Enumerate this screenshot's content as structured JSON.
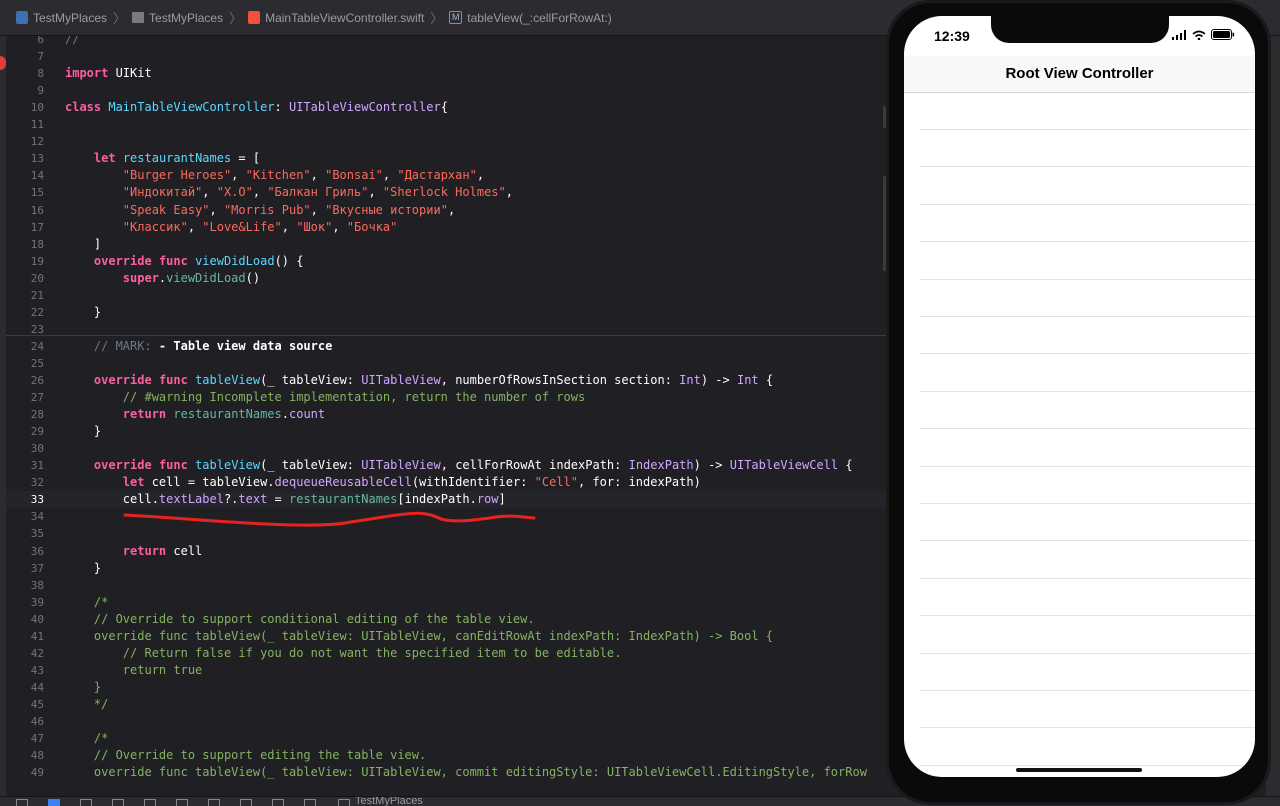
{
  "breadcrumb": {
    "project": "TestMyPlaces",
    "folder": "TestMyPlaces",
    "file": "MainTableViewController.swift",
    "method_badge": "M",
    "method": "tableView(_:cellForRowAt:)",
    "separator": "〉"
  },
  "editor": {
    "current_line": 33,
    "lines": [
      {
        "n": "6",
        "segs": [
          {
            "t": "//",
            "c": "cm"
          }
        ]
      },
      {
        "n": "7",
        "segs": []
      },
      {
        "n": "8",
        "segs": [
          {
            "t": "import",
            "c": "kw"
          },
          {
            "t": " UIKit",
            "c": ""
          }
        ]
      },
      {
        "n": "9",
        "segs": []
      },
      {
        "n": "10",
        "segs": [
          {
            "t": "class",
            "c": "kw"
          },
          {
            "t": " ",
            "c": ""
          },
          {
            "t": "MainTableViewController",
            "c": "ty"
          },
          {
            "t": ": ",
            "c": ""
          },
          {
            "t": "UITableViewController",
            "c": "pty"
          },
          {
            "t": "{",
            "c": ""
          }
        ]
      },
      {
        "n": "11",
        "segs": []
      },
      {
        "n": "12",
        "segs": []
      },
      {
        "n": "13",
        "segs": [
          {
            "t": "    ",
            "c": ""
          },
          {
            "t": "let",
            "c": "kw"
          },
          {
            "t": " ",
            "c": ""
          },
          {
            "t": "restaurantNames",
            "c": "ty"
          },
          {
            "t": " = [",
            "c": ""
          }
        ]
      },
      {
        "n": "14",
        "segs": [
          {
            "t": "        ",
            "c": ""
          },
          {
            "t": "\"Burger Heroes\"",
            "c": "st"
          },
          {
            "t": ", ",
            "c": ""
          },
          {
            "t": "\"Kitchen\"",
            "c": "st"
          },
          {
            "t": ", ",
            "c": ""
          },
          {
            "t": "\"Bonsai\"",
            "c": "st"
          },
          {
            "t": ", ",
            "c": ""
          },
          {
            "t": "\"Дастархан\"",
            "c": "st"
          },
          {
            "t": ",",
            "c": ""
          }
        ]
      },
      {
        "n": "15",
        "segs": [
          {
            "t": "        ",
            "c": ""
          },
          {
            "t": "\"Индокитай\"",
            "c": "st"
          },
          {
            "t": ", ",
            "c": ""
          },
          {
            "t": "\"X.O\"",
            "c": "st"
          },
          {
            "t": ", ",
            "c": ""
          },
          {
            "t": "\"Балкан Гриль\"",
            "c": "st"
          },
          {
            "t": ", ",
            "c": ""
          },
          {
            "t": "\"Sherlock Holmes\"",
            "c": "st"
          },
          {
            "t": ",",
            "c": ""
          }
        ]
      },
      {
        "n": "16",
        "segs": [
          {
            "t": "        ",
            "c": ""
          },
          {
            "t": "\"Speak Easy\"",
            "c": "st"
          },
          {
            "t": ", ",
            "c": ""
          },
          {
            "t": "\"Morris Pub\"",
            "c": "st"
          },
          {
            "t": ", ",
            "c": ""
          },
          {
            "t": "\"Вкусные истории\"",
            "c": "st"
          },
          {
            "t": ",",
            "c": ""
          }
        ]
      },
      {
        "n": "17",
        "segs": [
          {
            "t": "        ",
            "c": ""
          },
          {
            "t": "\"Классик\"",
            "c": "st"
          },
          {
            "t": ", ",
            "c": ""
          },
          {
            "t": "\"Love&Life\"",
            "c": "st"
          },
          {
            "t": ", ",
            "c": ""
          },
          {
            "t": "\"Шок\"",
            "c": "st"
          },
          {
            "t": ", ",
            "c": ""
          },
          {
            "t": "\"Бочка\"",
            "c": "st"
          }
        ]
      },
      {
        "n": "18",
        "segs": [
          {
            "t": "    ]",
            "c": ""
          }
        ]
      },
      {
        "n": "19",
        "segs": [
          {
            "t": "    ",
            "c": ""
          },
          {
            "t": "override",
            "c": "kw"
          },
          {
            "t": " ",
            "c": ""
          },
          {
            "t": "func",
            "c": "kw"
          },
          {
            "t": " ",
            "c": ""
          },
          {
            "t": "viewDidLoad",
            "c": "ty"
          },
          {
            "t": "() {",
            "c": ""
          }
        ]
      },
      {
        "n": "20",
        "segs": [
          {
            "t": "        ",
            "c": ""
          },
          {
            "t": "super",
            "c": "kw"
          },
          {
            "t": ".",
            "c": ""
          },
          {
            "t": "viewDidLoad",
            "c": "prop"
          },
          {
            "t": "()",
            "c": ""
          }
        ]
      },
      {
        "n": "21",
        "segs": []
      },
      {
        "n": "22",
        "segs": [
          {
            "t": "    }",
            "c": ""
          }
        ]
      },
      {
        "n": "23",
        "segs": []
      },
      {
        "n": "24",
        "segs": [
          {
            "t": "    // MARK: ",
            "c": "cm"
          },
          {
            "t": "- Table view data source",
            "c": "mark-b"
          }
        ]
      },
      {
        "n": "25",
        "segs": []
      },
      {
        "n": "26",
        "segs": [
          {
            "t": "    ",
            "c": ""
          },
          {
            "t": "override",
            "c": "kw"
          },
          {
            "t": " ",
            "c": ""
          },
          {
            "t": "func",
            "c": "kw"
          },
          {
            "t": " ",
            "c": ""
          },
          {
            "t": "tableView",
            "c": "ty"
          },
          {
            "t": "(_ tableView: ",
            "c": ""
          },
          {
            "t": "UITableView",
            "c": "pty"
          },
          {
            "t": ", numberOfRowsInSection section: ",
            "c": ""
          },
          {
            "t": "Int",
            "c": "pty"
          },
          {
            "t": ") -> ",
            "c": ""
          },
          {
            "t": "Int",
            "c": "pty"
          },
          {
            "t": " {",
            "c": ""
          }
        ]
      },
      {
        "n": "27",
        "segs": [
          {
            "t": "        // #warning Incomplete implementation, return the number of rows",
            "c": "cm-doc"
          }
        ]
      },
      {
        "n": "28",
        "segs": [
          {
            "t": "        ",
            "c": ""
          },
          {
            "t": "return",
            "c": "kw"
          },
          {
            "t": " ",
            "c": ""
          },
          {
            "t": "restaurantNames",
            "c": "prop"
          },
          {
            "t": ".",
            "c": ""
          },
          {
            "t": "count",
            "c": "pty"
          }
        ]
      },
      {
        "n": "29",
        "segs": [
          {
            "t": "    }",
            "c": ""
          }
        ]
      },
      {
        "n": "30",
        "segs": []
      },
      {
        "n": "31",
        "segs": [
          {
            "t": "    ",
            "c": ""
          },
          {
            "t": "override",
            "c": "kw"
          },
          {
            "t": " ",
            "c": ""
          },
          {
            "t": "func",
            "c": "kw"
          },
          {
            "t": " ",
            "c": ""
          },
          {
            "t": "tableView",
            "c": "ty"
          },
          {
            "t": "(_ tableView: ",
            "c": ""
          },
          {
            "t": "UITableView",
            "c": "pty"
          },
          {
            "t": ", cellForRowAt indexPath: ",
            "c": ""
          },
          {
            "t": "IndexPath",
            "c": "pty"
          },
          {
            "t": ") -> ",
            "c": ""
          },
          {
            "t": "UITableViewCell",
            "c": "pty"
          },
          {
            "t": " {",
            "c": ""
          }
        ]
      },
      {
        "n": "32",
        "segs": [
          {
            "t": "        ",
            "c": ""
          },
          {
            "t": "let",
            "c": "kw"
          },
          {
            "t": " cell = tableView.",
            "c": ""
          },
          {
            "t": "dequeueReusableCell",
            "c": "pty"
          },
          {
            "t": "(withIdentifier: ",
            "c": ""
          },
          {
            "t": "\"Cell\"",
            "c": "st"
          },
          {
            "t": ", for: indexPath)",
            "c": ""
          }
        ]
      },
      {
        "n": "33",
        "segs": [
          {
            "t": "        cell.",
            "c": ""
          },
          {
            "t": "textLabel",
            "c": "pty"
          },
          {
            "t": "?.",
            "c": ""
          },
          {
            "t": "text",
            "c": "pty"
          },
          {
            "t": " = ",
            "c": ""
          },
          {
            "t": "restaurantNames",
            "c": "prop"
          },
          {
            "t": "[indexPath.",
            "c": ""
          },
          {
            "t": "row",
            "c": "pty"
          },
          {
            "t": "]",
            "c": ""
          }
        ]
      },
      {
        "n": "34",
        "segs": []
      },
      {
        "n": "35",
        "segs": []
      },
      {
        "n": "36",
        "segs": [
          {
            "t": "        ",
            "c": ""
          },
          {
            "t": "return",
            "c": "kw"
          },
          {
            "t": " cell",
            "c": ""
          }
        ]
      },
      {
        "n": "37",
        "segs": [
          {
            "t": "    }",
            "c": ""
          }
        ]
      },
      {
        "n": "38",
        "segs": []
      },
      {
        "n": "39",
        "segs": [
          {
            "t": "    /*",
            "c": "cm-doc"
          }
        ]
      },
      {
        "n": "40",
        "segs": [
          {
            "t": "    // Override to support conditional editing of the table view.",
            "c": "cm-doc"
          }
        ]
      },
      {
        "n": "41",
        "segs": [
          {
            "t": "    override func tableView(_ tableView: UITableView, canEditRowAt indexPath: IndexPath) -> Bool {",
            "c": "cm-doc"
          }
        ]
      },
      {
        "n": "42",
        "segs": [
          {
            "t": "        // Return false if you do not want the specified item to be editable.",
            "c": "cm-doc"
          }
        ]
      },
      {
        "n": "43",
        "segs": [
          {
            "t": "        return true",
            "c": "cm-doc"
          }
        ]
      },
      {
        "n": "44",
        "segs": [
          {
            "t": "    }",
            "c": "cm-doc"
          }
        ]
      },
      {
        "n": "45",
        "segs": [
          {
            "t": "    */",
            "c": "cm-doc"
          }
        ]
      },
      {
        "n": "46",
        "segs": []
      },
      {
        "n": "47",
        "segs": [
          {
            "t": "    /*",
            "c": "cm-doc"
          }
        ]
      },
      {
        "n": "48",
        "segs": [
          {
            "t": "    // Override to support editing the table view.",
            "c": "cm-doc"
          }
        ]
      },
      {
        "n": "49",
        "segs": [
          {
            "t": "    override func tableView(_ tableView: UITableView, commit editingStyle: UITableViewCell.EditingStyle, forRow",
            "c": "cm-doc"
          }
        ]
      }
    ]
  },
  "bottom_bar": {
    "target": "TestMyPlaces"
  },
  "simulator": {
    "time": "12:39",
    "nav_title": "Root View Controller",
    "row_count": 18
  }
}
